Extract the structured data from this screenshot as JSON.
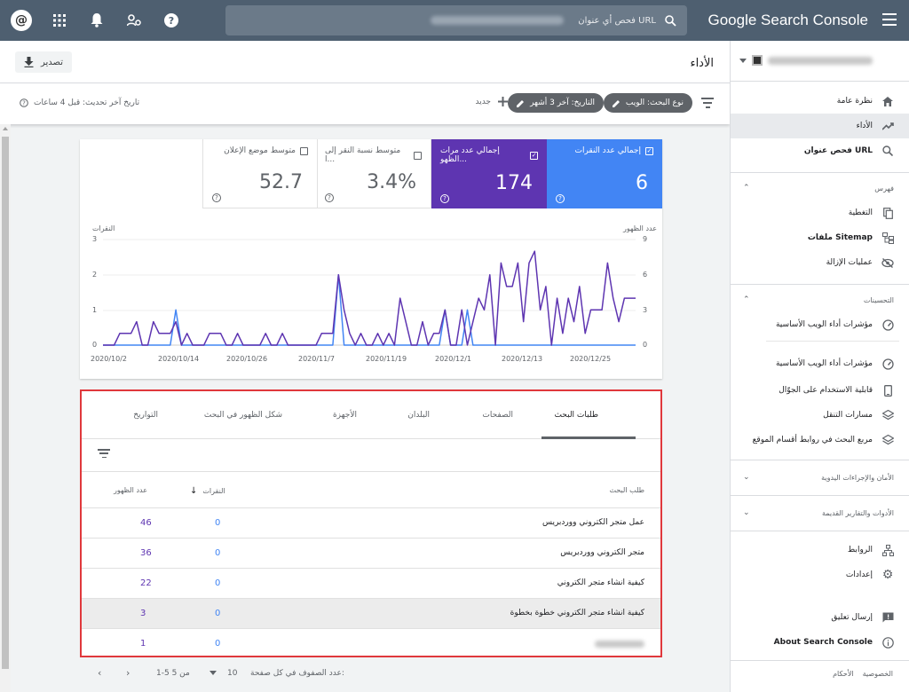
{
  "topbar": {
    "avatar_letter": "@",
    "search_placeholder": "فحص أي عنوان URL",
    "brand": "Google Search Console"
  },
  "header": {
    "export_label": "تصدير",
    "title": "الأداء"
  },
  "filters": {
    "chip_search_type": "نوع البحث: الويب",
    "chip_date": "التاريخ: آخر 3 أشهر",
    "new_label": "جديد",
    "last_updated": "تاريخ آخر تحديث: قبل 4 ساعات"
  },
  "metrics": [
    {
      "label": "إجمالي عدد النقرات",
      "value": "6",
      "checked": true,
      "color": "#4285f4"
    },
    {
      "label": "إجمالي عدد مرات الظهو...",
      "value": "174",
      "checked": true,
      "color": "#5e35b1"
    },
    {
      "label": "متوسط نسبة النقر إلى ا...",
      "value": "3.4%",
      "checked": false
    },
    {
      "label": "متوسط موضع الإعلان",
      "value": "52.7",
      "checked": false
    }
  ],
  "chart_data": {
    "type": "line",
    "left_axis_title": "النقرات",
    "right_axis_title": "عدد الظهور",
    "left_ticks": [
      "3",
      "2",
      "1",
      "0"
    ],
    "right_ticks": [
      "9",
      "6",
      "3",
      "0"
    ],
    "x_ticks": [
      "2020/10/2",
      "2020/10/14",
      "2020/10/26",
      "2020/11/7",
      "2020/11/19",
      "2020/12/1",
      "2020/12/13",
      "2020/12/25"
    ],
    "ylim_left": [
      0,
      3
    ],
    "ylim_right": [
      0,
      9
    ],
    "series": [
      {
        "name": "النقرات",
        "color": "#4285f4",
        "axis": "left",
        "values": [
          0,
          0,
          0,
          0,
          0,
          0,
          0,
          0,
          0,
          0,
          0,
          0,
          0,
          1,
          0,
          0,
          0,
          0,
          0,
          0,
          0,
          0,
          0,
          0,
          0,
          0,
          0,
          0,
          0,
          0,
          0,
          0,
          0,
          0,
          0,
          0,
          0,
          0,
          0,
          0,
          0,
          0,
          2,
          0,
          0,
          0,
          0,
          0,
          0,
          0,
          0,
          0,
          0,
          0,
          0,
          0,
          0,
          0,
          0,
          0,
          0,
          1,
          0,
          0,
          0,
          1,
          0,
          0,
          0,
          0,
          0,
          0,
          0,
          0,
          0,
          0,
          0,
          0,
          0,
          0,
          0,
          0,
          0,
          0,
          0,
          0,
          0,
          0,
          0,
          0,
          0,
          0,
          0,
          0,
          0,
          0
        ]
      },
      {
        "name": "عدد الظهور",
        "color": "#5e35b1",
        "axis": "right",
        "values": [
          0,
          0,
          0,
          1,
          1,
          1,
          2,
          0,
          0,
          2,
          1,
          1,
          1,
          2,
          0,
          1,
          0,
          0,
          0,
          1,
          1,
          1,
          0,
          0,
          1,
          0,
          0,
          0,
          0,
          1,
          0,
          0,
          1,
          0,
          0,
          0,
          0,
          0,
          0,
          1,
          1,
          1,
          6,
          3,
          1,
          0,
          1,
          0,
          0,
          1,
          0,
          1,
          0,
          4,
          2,
          0,
          0,
          2,
          0,
          1,
          1,
          3,
          0,
          0,
          3,
          0,
          2,
          4,
          3,
          6,
          0,
          7,
          5,
          5,
          7,
          2,
          7,
          8,
          3,
          5,
          0,
          4,
          1,
          4,
          2,
          5,
          1,
          3,
          3,
          3,
          7,
          4,
          2,
          4,
          4,
          4
        ]
      }
    ]
  },
  "table": {
    "tabs": [
      "طلبات البحث",
      "الصفحات",
      "البلدان",
      "الأجهزة",
      "شكل الظهور في البحث",
      "التواريخ"
    ],
    "col_query": "طلب البحث",
    "col_clicks": "النقرات",
    "col_impressions": "عدد الظهور",
    "rows": [
      {
        "query": "عمل متجر الكتروني ووردبريس",
        "clicks": "0",
        "impressions": "46"
      },
      {
        "query": "متجر الكتروني ووردبريس",
        "clicks": "0",
        "impressions": "36"
      },
      {
        "query": "كيفية انشاء متجر الكتروني",
        "clicks": "0",
        "impressions": "22"
      },
      {
        "query": "كيفية انشاء متجر الكتروني خطوة بخطوة",
        "clicks": "0",
        "impressions": "3"
      },
      {
        "query": "",
        "clicks": "0",
        "impressions": "1"
      }
    ]
  },
  "pager": {
    "rows_per_page_label": "عدد الصفوف في كل صفحة:",
    "rows_per_page": "10",
    "range": "1-5 من 5"
  },
  "sidebar": {
    "items": [
      {
        "label": "نظرة عامة",
        "icon": "home-icon"
      },
      {
        "label": "الأداء",
        "icon": "trending-up-icon"
      },
      {
        "label": "فحص عنوان URL",
        "icon": "search-icon"
      }
    ],
    "section_index": "فهرس",
    "index_items": [
      {
        "label": "التغطية",
        "icon": "copy-icon"
      },
      {
        "label": "ملفات Sitemap",
        "icon": "sitemap-icon"
      },
      {
        "label": "عمليات الإزالة",
        "icon": "eye-off-icon"
      }
    ],
    "section_enhancements": "التحسينات",
    "enh_items": [
      {
        "label": "مؤشرات أداء الويب الأساسية",
        "icon": "gauge-icon"
      },
      {
        "label": "مؤشرات أداء الويب الأساسية",
        "icon": "gauge-icon"
      },
      {
        "label": "قابلية الاستخدام على الجوّال",
        "icon": "phone-icon"
      },
      {
        "label": "مسارات التنقل",
        "icon": "layers-icon"
      },
      {
        "label": "مربع البحث في روابط أقسام الموقع",
        "icon": "layers-icon"
      }
    ],
    "section_security": "الأمان والإجراءات اليدوية",
    "section_legacy": "الأدوات والتقارير القديمة",
    "links_label": "الروابط",
    "settings_label": "إعدادات",
    "feedback_label": "إرسال تعليق",
    "about_label": "About Search Console",
    "footer_privacy": "الخصوصية",
    "footer_terms": "الأحكام"
  }
}
